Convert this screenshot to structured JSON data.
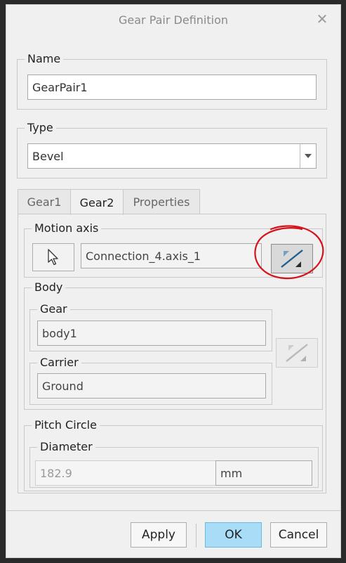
{
  "dialog": {
    "title": "Gear Pair Definition",
    "close_glyph": "✕"
  },
  "name_group": {
    "legend": "Name",
    "value": "GearPair1"
  },
  "type_group": {
    "legend": "Type",
    "value": "Bevel"
  },
  "tabs": [
    {
      "label": "Gear1",
      "active": false
    },
    {
      "label": "Gear2",
      "active": true
    },
    {
      "label": "Properties",
      "active": false
    }
  ],
  "motion_axis": {
    "legend": "Motion axis",
    "value": "Connection_4.axis_1"
  },
  "body": {
    "legend": "Body",
    "gear_legend": "Gear",
    "gear_value": "body1",
    "carrier_legend": "Carrier",
    "carrier_value": "Ground"
  },
  "pitch_circle": {
    "legend": "Pitch Circle",
    "diameter_legend": "Diameter",
    "diameter_value": "182.9",
    "unit": "mm"
  },
  "footer": {
    "apply": "Apply",
    "ok": "OK",
    "cancel": "Cancel"
  },
  "colors": {
    "ok_button": "#a9dcf7",
    "annotation_circle": "#d4141c"
  }
}
